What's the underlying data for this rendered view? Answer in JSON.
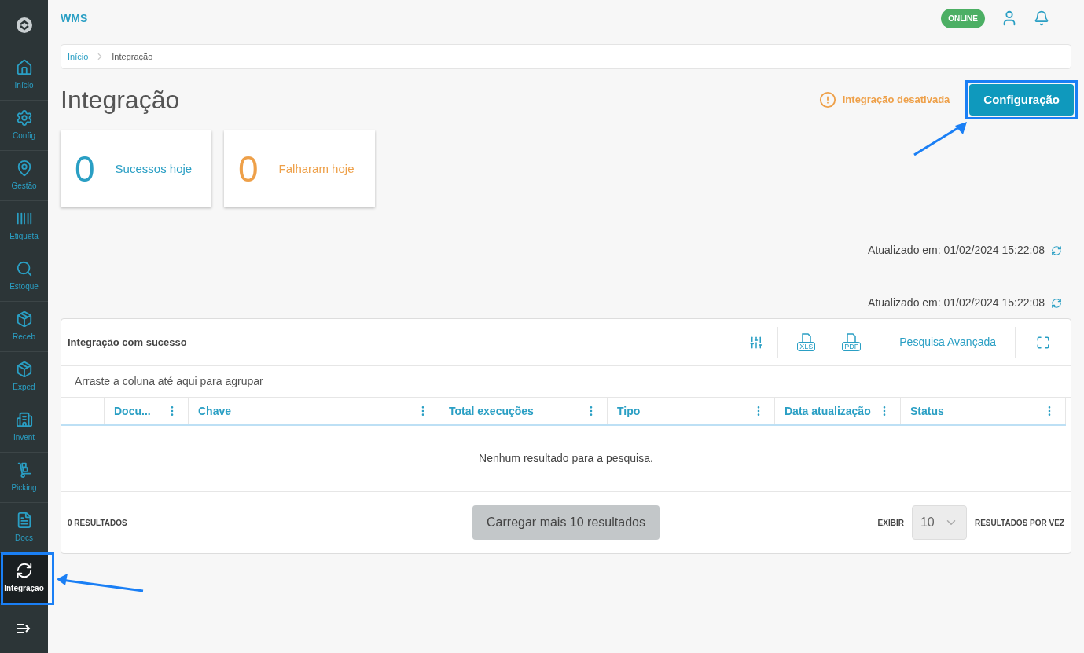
{
  "sidebar": {
    "items": [
      {
        "kind": "home",
        "label": "Início",
        "selected": false
      },
      {
        "kind": "gear",
        "label": "Config",
        "selected": false
      },
      {
        "kind": "pin",
        "label": "Gestão",
        "selected": false
      },
      {
        "kind": "barcode",
        "label": "Etiqueta",
        "selected": false
      },
      {
        "kind": "search",
        "label": "Estoque",
        "selected": false
      },
      {
        "kind": "box",
        "label": "Receb",
        "selected": false
      },
      {
        "kind": "box",
        "label": "Exped",
        "selected": false
      },
      {
        "kind": "building",
        "label": "Invent",
        "selected": false
      },
      {
        "kind": "truck",
        "label": "Picking",
        "selected": false
      },
      {
        "kind": "doc",
        "label": "Docs",
        "selected": false
      },
      {
        "kind": "sync",
        "label": "Integração",
        "selected": true
      }
    ]
  },
  "header": {
    "app_name": "WMS",
    "status_badge": "ONLINE"
  },
  "breadcrumb": [
    "Início",
    "Integração"
  ],
  "page": {
    "title": "Integração",
    "warning": "Integração desativada",
    "config_button": "Configuração"
  },
  "stats": [
    {
      "value": "0",
      "label": "Sucessos hoje",
      "color": "#2a9fc4"
    },
    {
      "value": "0",
      "label": "Falharam hoje",
      "color": "#eea049"
    }
  ],
  "updated_lines": [
    "Atualizado em: 01/02/2024 15:22:08",
    "Atualizado em: 01/02/2024 15:22:08"
  ],
  "table": {
    "title": "Integração com sucesso",
    "export_labels": [
      "XLS",
      "PDF"
    ],
    "advanced_search": "Pesquisa Avançada",
    "group_hint": "Arraste a coluna até aqui para agrupar",
    "columns": [
      "Docu...",
      "Chave",
      "Total execuções",
      "Tipo",
      "Data atualização",
      "Status"
    ],
    "empty_message": "Nenhum resultado para a pesquisa.",
    "result_count": "0 RESULTADOS",
    "load_more": "Carregar mais 10 resultados",
    "show_label": "EXIBIR",
    "page_size": "10",
    "per_time_label": "RESULTADOS POR VEZ"
  }
}
